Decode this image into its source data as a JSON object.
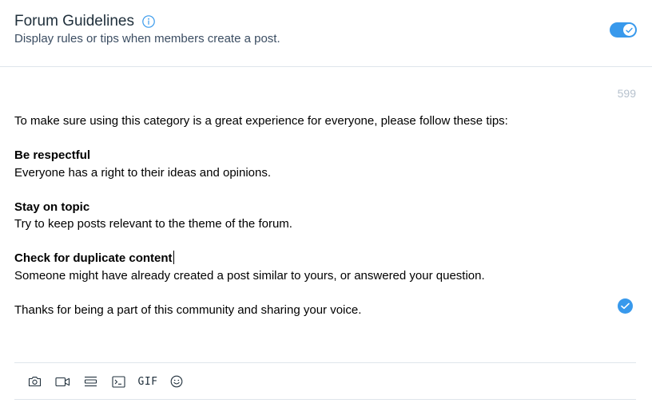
{
  "header": {
    "title": "Forum Guidelines",
    "subtitle": "Display rules or tips when members create a post.",
    "toggle_on": true,
    "accent_color": "#3899ec"
  },
  "editor": {
    "char_count": "599",
    "intro": "To make sure using this category is a great experience for everyone, please follow these tips:",
    "sections": [
      {
        "heading": "Be respectful",
        "body": "Everyone has a right to their ideas and opinions."
      },
      {
        "heading": "Stay on topic",
        "body": "Try to keep posts relevant to the theme of the forum."
      },
      {
        "heading": "Check for duplicate content",
        "body": "Someone might have already created a post similar to yours, or answered your question."
      }
    ],
    "closing": "Thanks for being a part of this community and sharing your voice."
  },
  "toolbar": {
    "tools": [
      {
        "name": "camera-icon"
      },
      {
        "name": "video-icon"
      },
      {
        "name": "divider-icon"
      },
      {
        "name": "code-block-icon"
      },
      {
        "name": "gif-button",
        "label": "GIF"
      },
      {
        "name": "emoji-icon"
      }
    ]
  }
}
